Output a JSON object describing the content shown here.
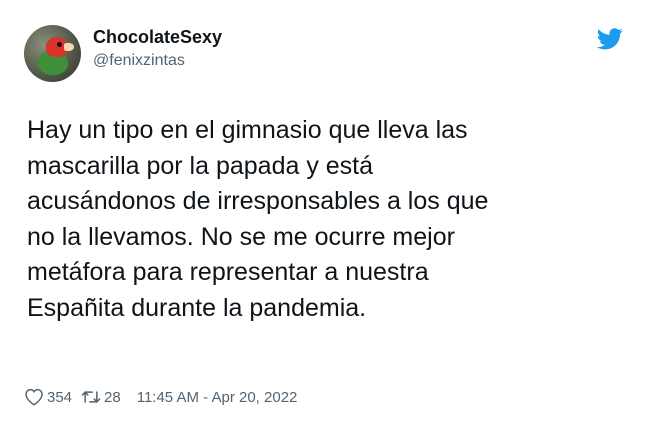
{
  "user": {
    "display_name": "ChocolateSexy",
    "handle": "@fenixzintas",
    "avatar_icon": "parrot-avatar"
  },
  "brand": {
    "logo_icon": "twitter-bird-icon",
    "color": "#1d9bf0"
  },
  "tweet": {
    "lines": [
      "Hay un tipo en el gimnasio que lleva las",
      "mascarilla por la papada y está",
      "acusándonos de irresponsables a los que",
      "no la llevamos. No se me ocurre mejor",
      "metáfora para representar a nuestra",
      "Españita durante la pandemia."
    ]
  },
  "stats": {
    "likes": "354",
    "retweets": "28",
    "timestamp": "11:45 AM - Apr 20, 2022",
    "like_icon": "heart-icon",
    "retweet_icon": "retweet-icon"
  },
  "colors": {
    "text_primary": "#0f1419",
    "text_secondary": "#536471"
  }
}
